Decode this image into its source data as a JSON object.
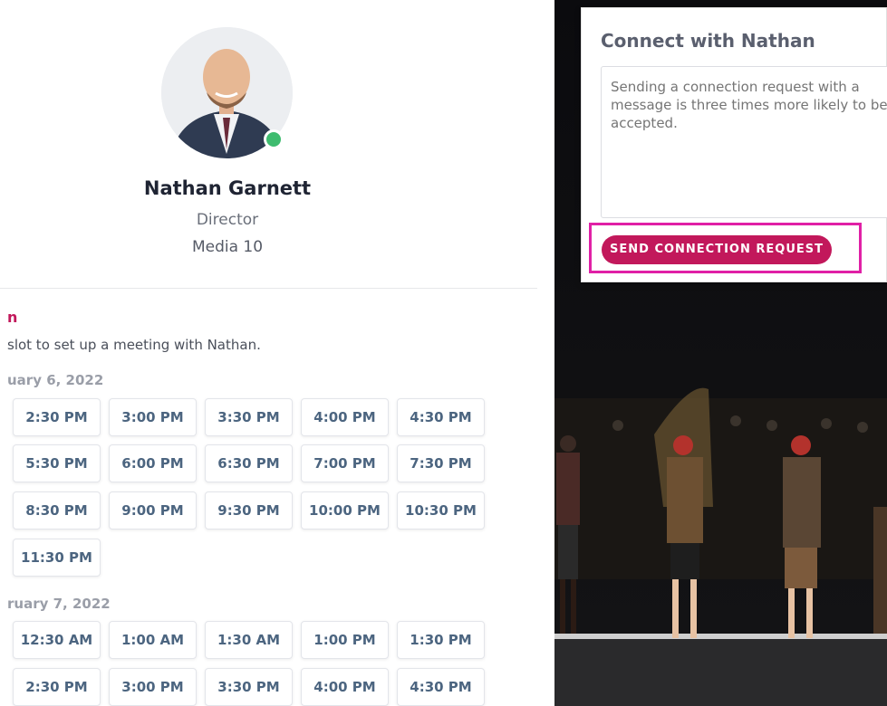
{
  "profile": {
    "name": "Nathan Garnett",
    "title": "Director",
    "company": "Media 10",
    "online": true
  },
  "schedule": {
    "heading": "n",
    "description": "slot to set up a meeting with Nathan.",
    "days": [
      {
        "date_label": "uary 6, 2022",
        "slots": [
          "2:30 PM",
          "3:00 PM",
          "3:30 PM",
          "4:00 PM",
          "4:30 PM",
          "5:30 PM",
          "6:00 PM",
          "6:30 PM",
          "7:00 PM",
          "7:30 PM",
          "8:30 PM",
          "9:00 PM",
          "9:30 PM",
          "10:00 PM",
          "10:30 PM",
          "11:30 PM"
        ]
      },
      {
        "date_label": "ruary 7, 2022",
        "slots": [
          "12:30 AM",
          "1:00 AM",
          "1:30 AM",
          "1:00 PM",
          "1:30 PM",
          "2:30 PM",
          "3:00 PM",
          "3:30 PM",
          "4:00 PM",
          "4:30 PM"
        ]
      }
    ]
  },
  "connect_popup": {
    "title": "Connect with Nathan",
    "message_placeholder": "Sending a connection request with a message is three times more likely to be accepted.",
    "send_button": "SEND CONNECTION REQUEST"
  },
  "colors": {
    "accent": "#c2185b",
    "highlight": "#e020a6",
    "online": "#3ebc6f"
  }
}
